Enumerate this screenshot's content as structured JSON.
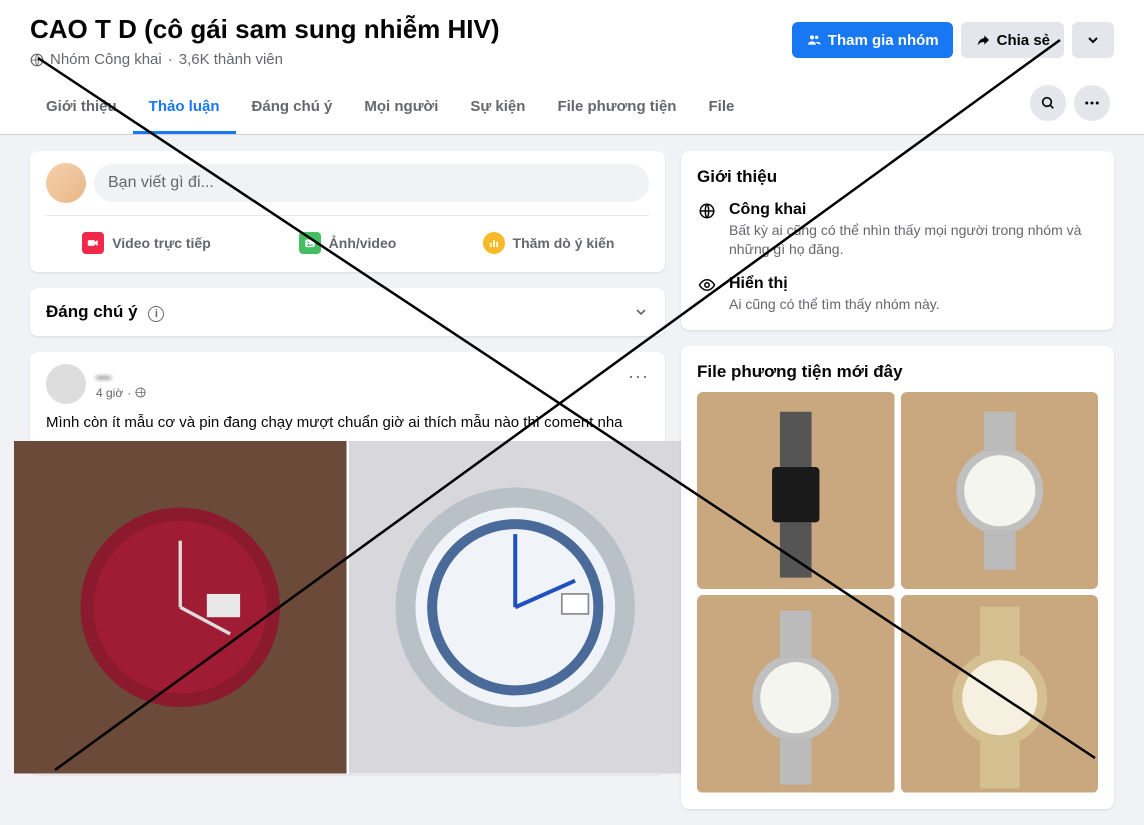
{
  "header": {
    "title": "CAO T     D       (cô gái sam sung nhiễm HIV)",
    "privacy": "Nhóm Công khai",
    "members": "3,6K thành viên",
    "join_label": "Tham gia nhóm",
    "share_label": "Chia sẻ"
  },
  "tabs": [
    {
      "label": "Giới thiệu",
      "active": false
    },
    {
      "label": "Thảo luận",
      "active": true
    },
    {
      "label": "Đáng chú ý",
      "active": false
    },
    {
      "label": "Mọi người",
      "active": false
    },
    {
      "label": "Sự kiện",
      "active": false
    },
    {
      "label": "File phương tiện",
      "active": false
    },
    {
      "label": "File",
      "active": false
    }
  ],
  "composer": {
    "placeholder": "Bạn viết gì đi...",
    "live_video": "Video trực tiếp",
    "photo_video": "Ảnh/video",
    "poll": "Thăm dò ý kiến"
  },
  "featured": {
    "title": "Đáng chú ý"
  },
  "post": {
    "author": "—",
    "time": "4 giờ",
    "text": "Mình còn ít mẫu cơ và pin đang chạy mượt chuẩn giờ ai thích mẫu nào thì coment nha"
  },
  "about": {
    "title": "Giới thiệu",
    "public_h": "Công khai",
    "public_d": "Bất kỳ ai cũng có thể nhìn thấy mọi người trong nhóm và những gì họ đăng.",
    "visible_h": "Hiển thị",
    "visible_d": "Ai cũng có thể tìm thấy nhóm này."
  },
  "recent_media": {
    "title": "File phương tiện mới đây"
  }
}
